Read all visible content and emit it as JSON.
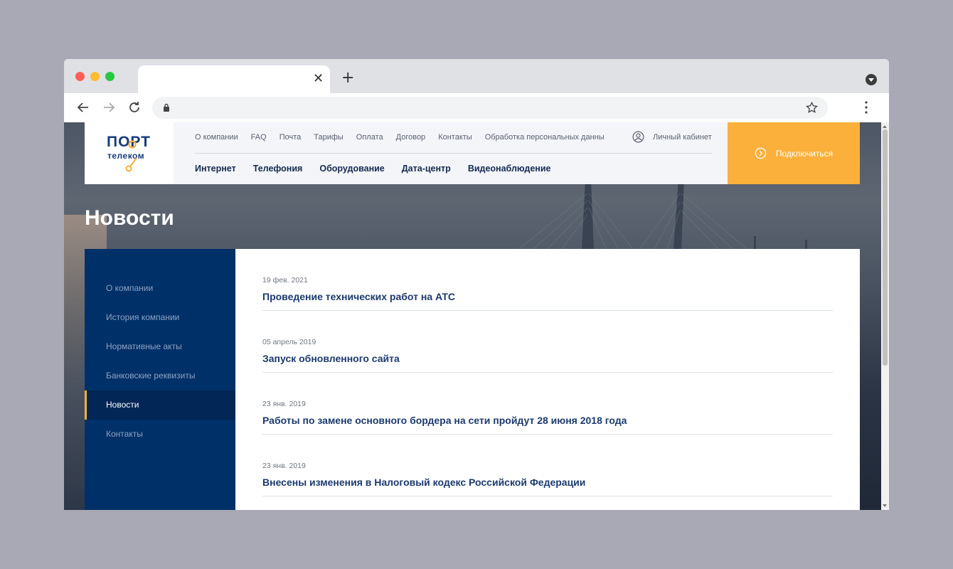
{
  "browser": {
    "tab_close": "✕",
    "new_tab": "+"
  },
  "site": {
    "logo": {
      "word1": "ПОРТ",
      "word2": "телеком"
    },
    "top_nav": [
      "О компании",
      "FAQ",
      "Почта",
      "Тарифы",
      "Оплата",
      "Договор",
      "Контакты",
      "Обработка персональных данны"
    ],
    "main_nav": [
      "Интернет",
      "Телефония",
      "Оборудование",
      "Дата-центр",
      "Видеонаблюдение"
    ],
    "cabinet_label": "Личный кабинет",
    "connect_label": "Подключиться",
    "accent_color": "#fbb03b",
    "brand_color": "#003068"
  },
  "page": {
    "title": "Новости"
  },
  "sidebar": {
    "items": [
      {
        "label": "О компании",
        "active": false
      },
      {
        "label": "История компании",
        "active": false
      },
      {
        "label": "Нормативные акты",
        "active": false
      },
      {
        "label": "Банковские реквизиты",
        "active": false
      },
      {
        "label": "Новости",
        "active": true
      },
      {
        "label": "Контакты",
        "active": false
      }
    ]
  },
  "news": [
    {
      "date": "19 фев. 2021",
      "title": "Проведение технических работ на АТС"
    },
    {
      "date": "05 апрель 2019",
      "title": "Запуск обновленного сайта"
    },
    {
      "date": "23 янв. 2019",
      "title": "Работы по замене основного бордера на сети пройдут 28 июня 2018 года"
    },
    {
      "date": "23 янв. 2019",
      "title": "Внесены изменения в Налоговый кодекс Российской Федерации"
    }
  ]
}
